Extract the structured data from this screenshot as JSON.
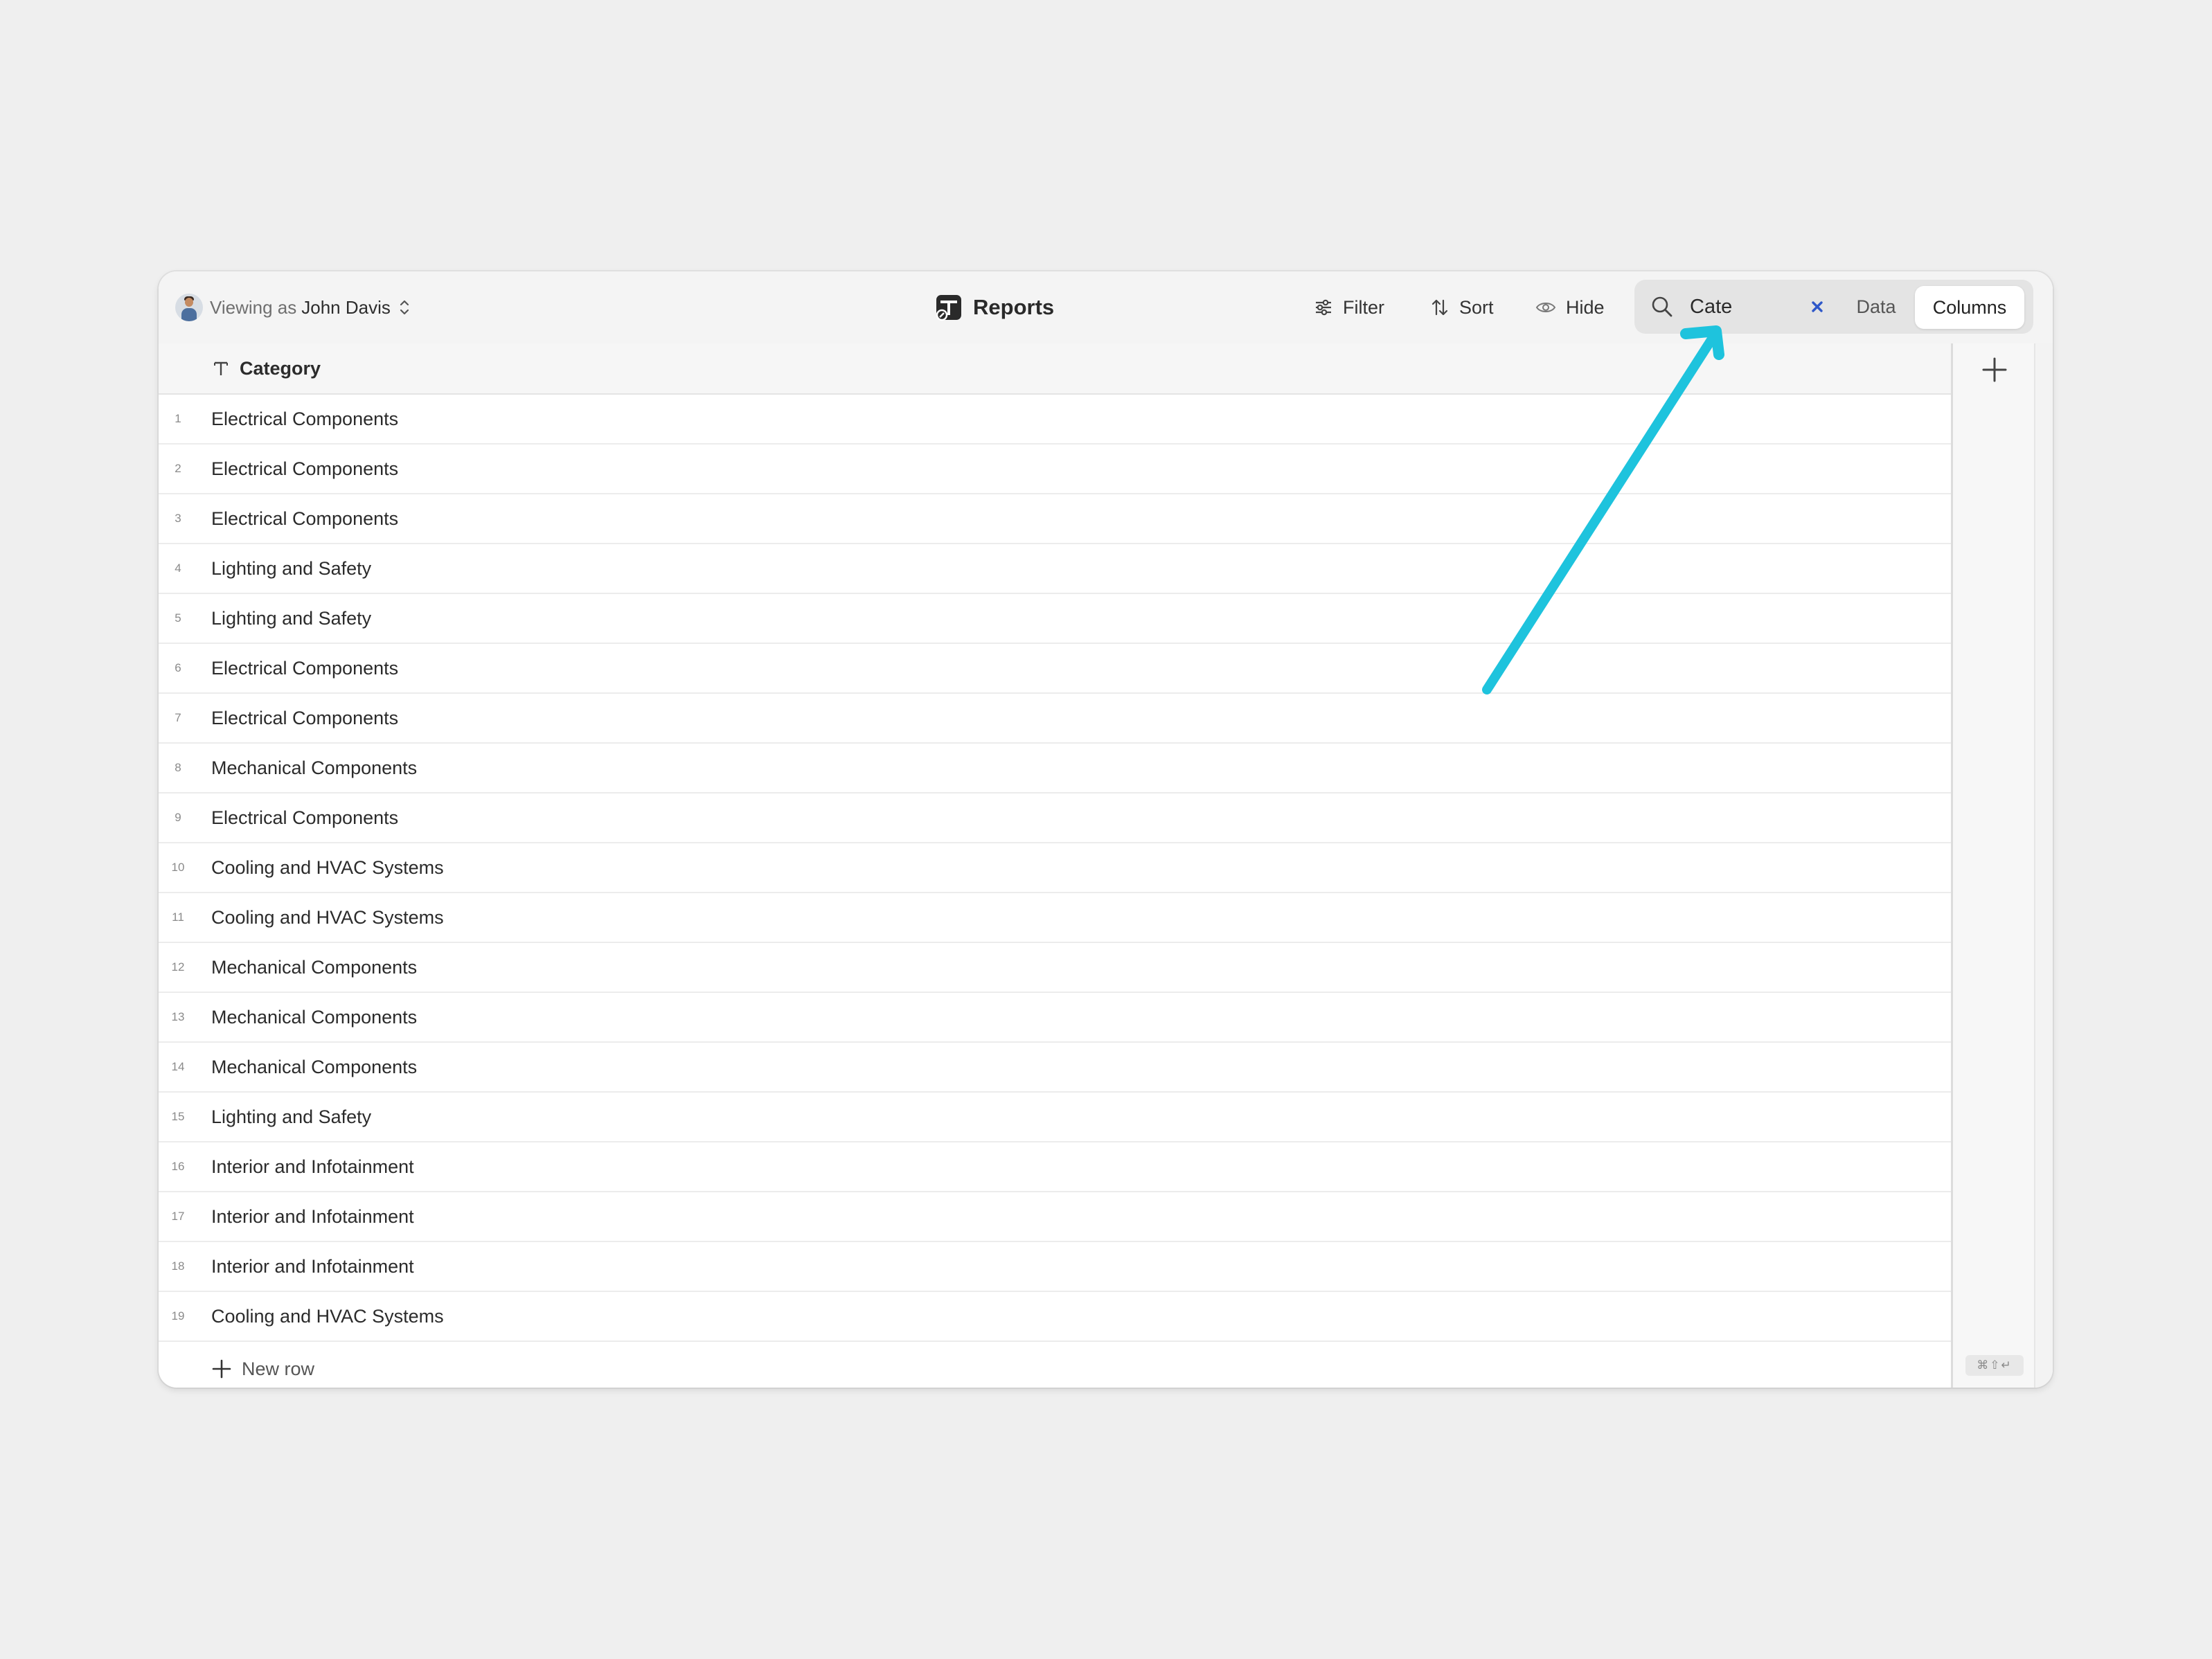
{
  "toolbar": {
    "viewing_prefix": "Viewing as",
    "viewing_user": "John Davis",
    "title": "Reports",
    "filter_label": "Filter",
    "sort_label": "Sort",
    "hide_label": "Hide",
    "search_value": "Cate",
    "segment_data": "Data",
    "segment_columns": "Columns",
    "selected_segment": "Columns"
  },
  "table": {
    "column_header": "Category",
    "rows": [
      {
        "num": "1",
        "category": "Electrical Components"
      },
      {
        "num": "2",
        "category": "Electrical Components"
      },
      {
        "num": "3",
        "category": "Electrical Components"
      },
      {
        "num": "4",
        "category": "Lighting and Safety"
      },
      {
        "num": "5",
        "category": "Lighting and Safety"
      },
      {
        "num": "6",
        "category": "Electrical Components"
      },
      {
        "num": "7",
        "category": "Electrical Components"
      },
      {
        "num": "8",
        "category": "Mechanical Components"
      },
      {
        "num": "9",
        "category": "Electrical Components"
      },
      {
        "num": "10",
        "category": "Cooling and HVAC Systems"
      },
      {
        "num": "11",
        "category": "Cooling and HVAC Systems"
      },
      {
        "num": "12",
        "category": "Mechanical Components"
      },
      {
        "num": "13",
        "category": "Mechanical Components"
      },
      {
        "num": "14",
        "category": "Mechanical Components"
      },
      {
        "num": "15",
        "category": "Lighting and Safety"
      },
      {
        "num": "16",
        "category": "Interior and Infotainment"
      },
      {
        "num": "17",
        "category": "Interior and Infotainment"
      },
      {
        "num": "18",
        "category": "Interior and Infotainment"
      },
      {
        "num": "19",
        "category": "Cooling and HVAC Systems"
      }
    ],
    "new_row_label": "New row",
    "shortcut_hint": "⌘⇧↵"
  },
  "icons": {
    "avatar": "user-avatar",
    "updown": "chevron-up-down-icon",
    "title": "table-app-icon",
    "filter": "sliders-icon",
    "sort": "sort-arrows-icon",
    "hide": "eye-icon",
    "search": "search-icon",
    "clear": "close-icon",
    "column_type": "text-type-icon",
    "add_column": "plus-icon",
    "new_row": "plus-icon"
  },
  "colors": {
    "annotation_arrow": "#1ec3dd",
    "clear_icon": "#2f58c9",
    "background": "#efefef"
  }
}
